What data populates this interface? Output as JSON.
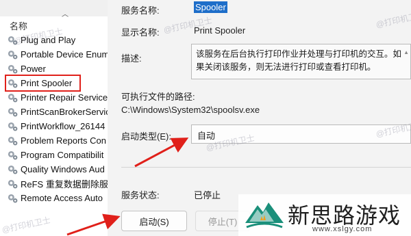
{
  "services_list": {
    "header": "名称",
    "items": [
      {
        "name": "Plug and Play"
      },
      {
        "name": "Portable Device Enum"
      },
      {
        "name": "Power"
      },
      {
        "name": "Print Spooler"
      },
      {
        "name": "Printer Repair Service"
      },
      {
        "name": "PrintScanBrokerServic"
      },
      {
        "name": "PrintWorkflow_26144"
      },
      {
        "name": "Problem Reports Con"
      },
      {
        "name": "Program Compatibilit"
      },
      {
        "name": "Quality Windows Aud"
      },
      {
        "name": "ReFS 重复数据删除服务"
      },
      {
        "name": "Remote Access Auto"
      }
    ],
    "highlight_color": "#e0201a"
  },
  "properties": {
    "service_name_label": "服务名称:",
    "service_name_value": "Spooler",
    "display_name_label": "显示名称:",
    "display_name_value": "Print Spooler",
    "description_label": "描述:",
    "description_value": "该服务在后台执行打印作业并处理与打印机的交互。如果关闭该服务，则无法进行打印或查看打印机。",
    "exe_path_label": "可执行文件的路径:",
    "exe_path_value": "C:\\Windows\\System32\\spoolsv.exe",
    "startup_type_label": "启动类型(E):",
    "startup_type_value": "自动",
    "status_label": "服务状态:",
    "status_value": "已停止",
    "start_button": "启动(S)",
    "stop_button": "停止(T)"
  },
  "watermark_text": "@打印机卫士",
  "logo": {
    "text": "新思路游戏",
    "url": "www.xslgy.com"
  },
  "colors": {
    "selection": "#1e6ec9",
    "arrow": "#e0201a"
  }
}
